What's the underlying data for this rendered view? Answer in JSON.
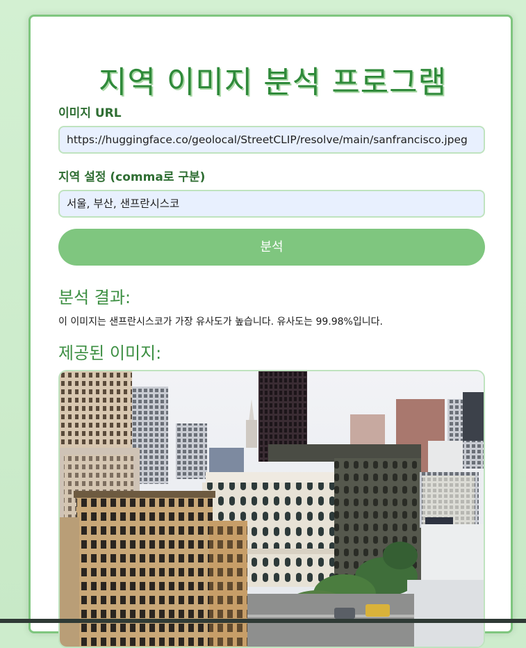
{
  "app": {
    "title": "지역 이미지 분석 프로그램"
  },
  "form": {
    "url_label": "이미지 URL",
    "url_value": "https://huggingface.co/geolocal/StreetCLIP/resolve/main/sanfrancisco.jpeg",
    "region_label": "지역 설정 (comma로 구분)",
    "region_value": "서울, 부산, 샌프란시스코",
    "submit_label": "분석"
  },
  "result": {
    "heading": "분석 결과:",
    "text": "이 이미지는 샌프란시스코가 가장 유사도가 높습니다. 유사도는 99.98%입니다.",
    "image_heading": "제공된 이미지:"
  },
  "colors": {
    "accent": "#7fc67f",
    "title": "#2f8a3a",
    "label": "#2f6e33",
    "input_bg": "#e8f0fe",
    "page_bg": "#cdeccc"
  },
  "image": {
    "subject": "san-francisco-street-view-photo"
  }
}
